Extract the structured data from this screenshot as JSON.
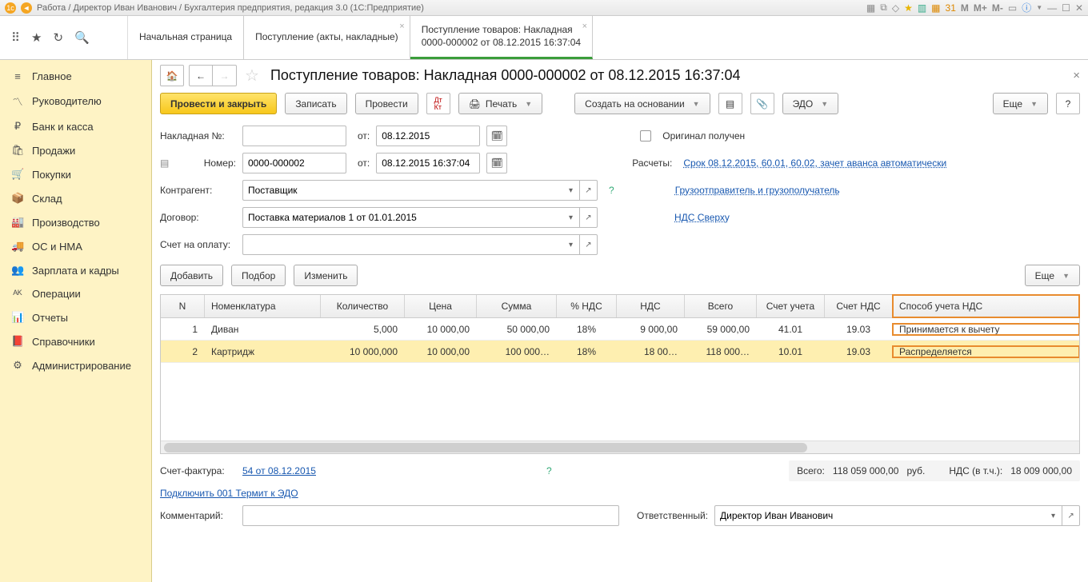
{
  "window": {
    "title": "Работа / Директор Иван Иванович / Бухгалтерия предприятия, редакция 3.0  (1С:Предприятие)",
    "m1": "M",
    "m2": "M+",
    "m3": "M-"
  },
  "tabs": {
    "t1": "Начальная страница",
    "t2": "Поступление (акты, накладные)",
    "t3a": "Поступление товаров: Накладная",
    "t3b": "0000-000002 от 08.12.2015 16:37:04"
  },
  "sidebar": {
    "items": [
      {
        "icon": "≡",
        "label": "Главное"
      },
      {
        "icon": "〽",
        "label": "Руководителю"
      },
      {
        "icon": "₽",
        "label": "Банк и касса"
      },
      {
        "icon": "🛍",
        "label": "Продажи"
      },
      {
        "icon": "🛒",
        "label": "Покупки"
      },
      {
        "icon": "📦",
        "label": "Склад"
      },
      {
        "icon": "🏭",
        "label": "Производство"
      },
      {
        "icon": "🚚",
        "label": "ОС и НМА"
      },
      {
        "icon": "👥",
        "label": "Зарплата и кадры"
      },
      {
        "icon": "ᴬᴷ",
        "label": "Операции"
      },
      {
        "icon": "📊",
        "label": "Отчеты"
      },
      {
        "icon": "📕",
        "label": "Справочники"
      },
      {
        "icon": "⚙",
        "label": "Администрирование"
      }
    ]
  },
  "page": {
    "title": "Поступление товаров: Накладная 0000-000002 от 08.12.2015 16:37:04",
    "toolbar": {
      "post_close": "Провести и закрыть",
      "save": "Записать",
      "post": "Провести",
      "print": "Печать",
      "create_based": "Создать на основании",
      "edo": "ЭДО",
      "more": "Еще"
    },
    "form": {
      "invoice_no_lbl": "Накладная №:",
      "invoice_no": "",
      "from_lbl": "от:",
      "invoice_date": "08.12.2015",
      "original_lbl": "Оригинал получен",
      "number_lbl": "Номер:",
      "number": "0000-000002",
      "datetime": "08.12.2015 16:37:04",
      "calc_lbl": "Расчеты:",
      "calc_link": "Срок 08.12.2015, 60.01, 60.02, зачет аванса автоматически",
      "counterparty_lbl": "Контрагент:",
      "counterparty": "Поставщик",
      "shipper_link": "Грузоотправитель и грузополучатель",
      "contract_lbl": "Договор:",
      "contract": "Поставка материалов 1 от 01.01.2015",
      "vat_link": "НДС Сверху",
      "payacc_lbl": "Счет на оплату:",
      "payacc": ""
    },
    "tabletool": {
      "add": "Добавить",
      "select": "Подбор",
      "edit": "Изменить",
      "more": "Еще"
    },
    "cols": {
      "n": "N",
      "nom": "Номенклатура",
      "qty": "Количество",
      "price": "Цена",
      "sum": "Сумма",
      "vatp": "% НДС",
      "vat": "НДС",
      "total": "Всего",
      "acc": "Счет учета",
      "vatacc": "Счет НДС",
      "vatmethod": "Способ учета НДС"
    },
    "rows": [
      {
        "n": "1",
        "nom": "Диван",
        "qty": "5,000",
        "price": "10 000,00",
        "sum": "50 000,00",
        "vatp": "18%",
        "vat": "9 000,00",
        "total": "59 000,00",
        "acc": "41.01",
        "vatacc": "19.03",
        "vatmethod": "Принимается к вычету"
      },
      {
        "n": "2",
        "nom": "Картридж",
        "qty": "10 000,000",
        "price": "10 000,00",
        "sum": "100 000…",
        "vatp": "18%",
        "vat": "18 00…",
        "total": "118 000…",
        "acc": "10.01",
        "vatacc": "19.03",
        "vatmethod": "Распределяется"
      }
    ],
    "footer": {
      "sf_lbl": "Счет-фактура:",
      "sf_link": "54 от 08.12.2015",
      "edo_link": "Подключить 001 Термит к ЭДО",
      "comment_lbl": "Комментарий:",
      "comment": "",
      "resp_lbl": "Ответственный:",
      "resp": "Директор Иван Иванович",
      "total_lbl": "Всего:",
      "total": "118 059 000,00",
      "cur": "руб.",
      "vat_lbl": "НДС (в т.ч.):",
      "vat": "18 009 000,00"
    }
  }
}
